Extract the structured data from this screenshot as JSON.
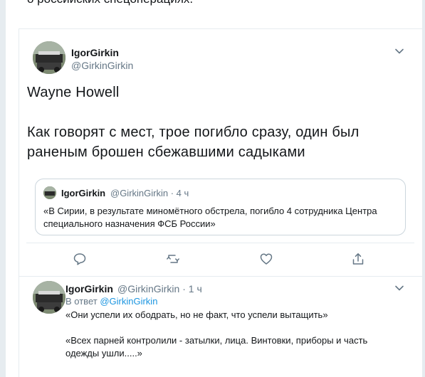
{
  "top_text": "о российских спецоперациях.",
  "main_tweet": {
    "author_name": "IgorGirkin",
    "author_handle": "@GirkinGirkin",
    "line1": "Wayne Howell",
    "line2": "Как говорят с мест, трое погибло сразу, один был",
    "line3": "раненым брошен сбежавшими садыками",
    "quoted": {
      "author_name": "IgorGirkin",
      "meta": "@GirkinGirkin · 4 ч",
      "line1": "«В Сирии, в результате миномётного обстрела, погибло 4 сотрудника Центра",
      "line2": "специального назначения ФСБ России»"
    }
  },
  "reply_tweet": {
    "author_name": "IgorGirkin",
    "meta": "@GirkinGirkin · 1 ч",
    "in_reply_prefix": "В ответ",
    "in_reply_handle": "@GirkinGirkin",
    "line1": "«Они успели их ободрать, но не факт, что успели вытащить»",
    "line2": "«Всех парней контролили - затылки, лица. Винтовки, приборы и часть",
    "line3": "одежды ушли.....»"
  },
  "icons": {
    "reply": "reply-icon",
    "retweet": "retweet-icon",
    "like": "like-icon",
    "share": "share-icon",
    "caret": "chevron-down-icon",
    "avatar": "avatar-image"
  },
  "colors": {
    "background": "#e6ecf0",
    "text": "#14171a",
    "secondary": "#657786",
    "link": "#1b95e0",
    "border": "#ccd6dd"
  }
}
